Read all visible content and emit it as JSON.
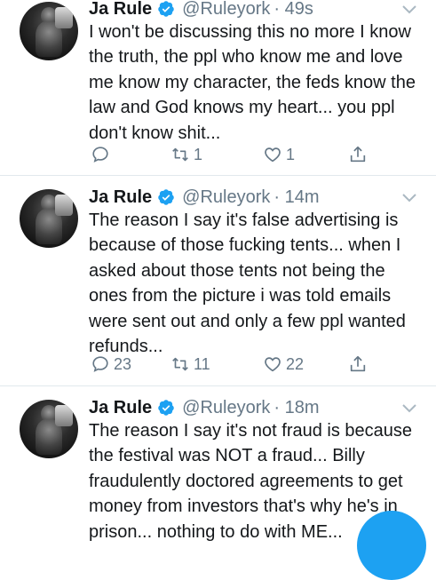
{
  "tweets": [
    {
      "name": "Ja Rule",
      "handle": "@Ruleyork",
      "time": "· 49s",
      "text": "I won't be discussing this no more I know the truth, the ppl who know me and love me know my character, the feds know the law and God knows my heart... you ppl don't know shit...",
      "replies": "",
      "retweets": "1",
      "likes": "1"
    },
    {
      "name": "Ja Rule",
      "handle": "@Ruleyork",
      "time": "· 14m",
      "text": "The reason I say it's false advertising is because of those fucking tents... when I asked about those tents not being the ones from the picture i was told emails were sent out and only a few ppl wanted refunds...",
      "replies": "23",
      "retweets": "11",
      "likes": "22"
    },
    {
      "name": "Ja Rule",
      "handle": "@Ruleyork",
      "time": "· 18m",
      "text": "The reason I say it's not fraud is because the festival was NOT a fraud... Billy fraudulently doctored agreements to get money from investors that's why he's in prison... nothing to do with ME..."
    }
  ],
  "icons": {
    "verified": "verified-badge-icon",
    "reply": "reply-icon",
    "retweet": "retweet-icon",
    "like": "heart-icon",
    "share": "share-icon",
    "caret": "chevron-down-icon"
  },
  "colors": {
    "accent": "#1da1f2",
    "muted": "#657786",
    "text": "#14171a"
  }
}
